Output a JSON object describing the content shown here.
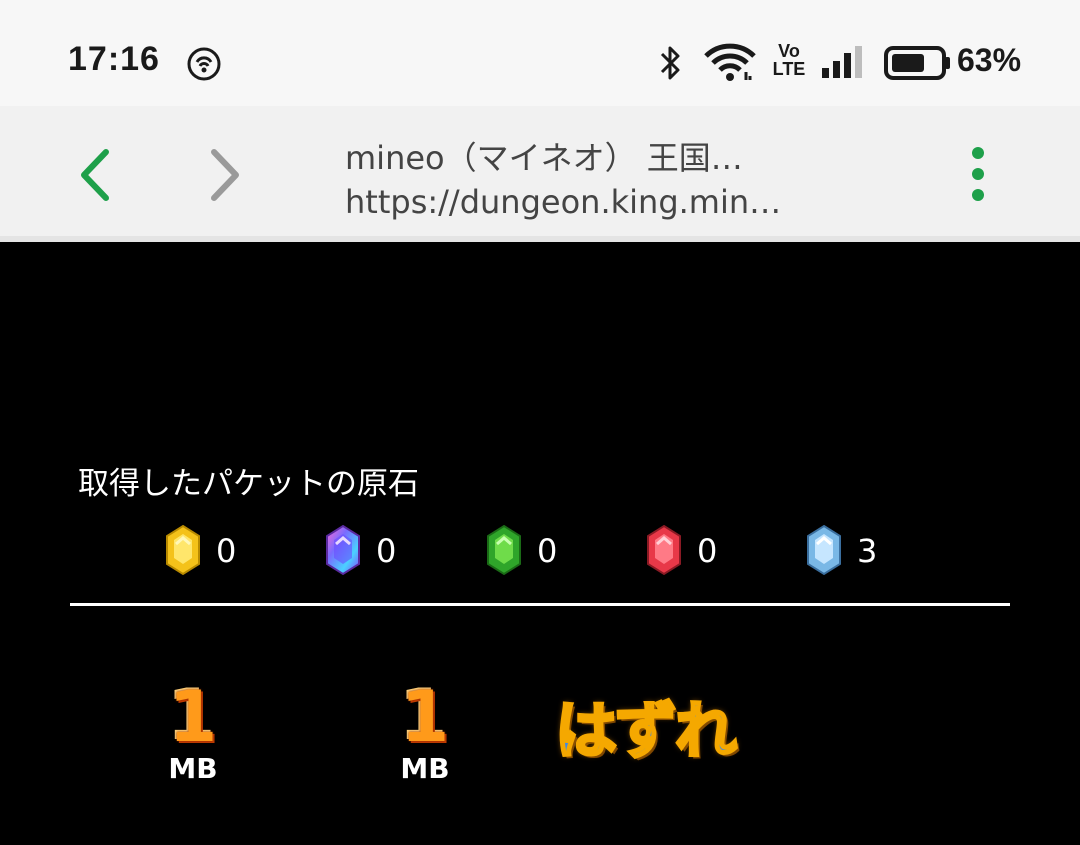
{
  "status_bar": {
    "time": "17:16",
    "battery": "63%",
    "icons": [
      "hotspot-icon",
      "bluetooth-icon",
      "wifi-icon",
      "volte-icon",
      "signal-icon",
      "battery-icon"
    ],
    "volte_text_top": "Vo",
    "volte_text_bottom": "LTE"
  },
  "browser": {
    "title": "mineo（マイネオ） 王国…",
    "url": "https://dungeon.king.min…",
    "back_color": "#1ea04a",
    "forward_color": "#9a9a9a",
    "menu_color": "#1ea04a"
  },
  "gems": {
    "title": "取得したパケットの原石",
    "items": [
      {
        "color": "yellow",
        "icon": "yellow-gem-icon",
        "count": "0"
      },
      {
        "color": "purple",
        "icon": "purple-gem-icon",
        "count": "0"
      },
      {
        "color": "green",
        "icon": "green-gem-icon",
        "count": "0"
      },
      {
        "color": "red",
        "icon": "red-gem-icon",
        "count": "0"
      },
      {
        "color": "blue",
        "icon": "blue-gem-icon",
        "count": "3"
      }
    ]
  },
  "results": {
    "prize1": {
      "value": "1",
      "unit": "MB"
    },
    "prize2": {
      "value": "1",
      "unit": "MB"
    },
    "miss": "はずれ"
  }
}
